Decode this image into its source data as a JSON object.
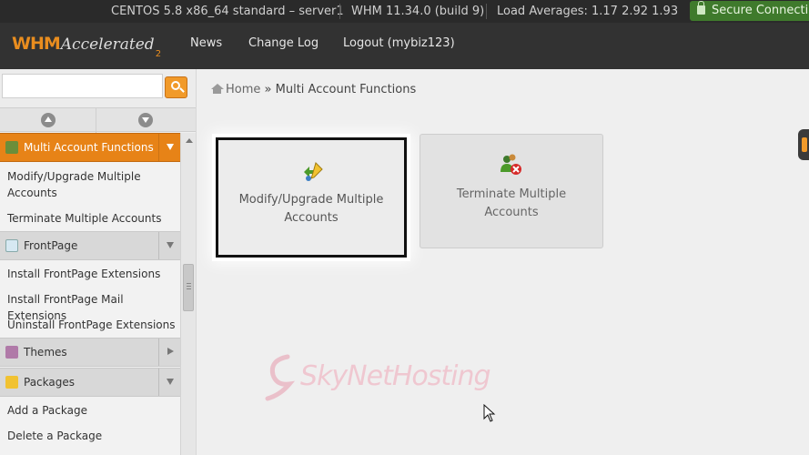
{
  "infobar": {
    "os": "CENTOS 5.8 x86_64 standard – server1",
    "version": "WHM 11.34.0 (build 9)",
    "load": "Load Averages: 1.17 2.92 1.93",
    "secure": "Secure Connection"
  },
  "header": {
    "logo_whm": "WHM",
    "logo_accelerated": "Accelerated",
    "logo_version": "2",
    "nav": [
      "News",
      "Change Log",
      "Logout (mybiz123)"
    ]
  },
  "search": {
    "value": "",
    "placeholder": ""
  },
  "sidebar": {
    "sections": [
      {
        "label": "Multi Account Functions",
        "items": [
          "Modify/Upgrade Multiple Accounts",
          "Terminate Multiple Accounts"
        ]
      },
      {
        "label": "FrontPage",
        "items": [
          "Install FrontPage Extensions",
          "Install FrontPage Mail Extensions",
          "Uninstall FrontPage Extensions"
        ]
      },
      {
        "label": "Themes",
        "items": []
      },
      {
        "label": "Packages",
        "items": [
          "Add a Package",
          "Delete a Package"
        ]
      }
    ]
  },
  "breadcrumb": {
    "home": "Home",
    "separator": "»",
    "current": "Multi Account Functions"
  },
  "tiles": [
    {
      "line1": "Modify/Upgrade Multiple",
      "line2": "Accounts",
      "icon": "modify-accounts-icon"
    },
    {
      "line1": "Terminate Multiple",
      "line2": "Accounts",
      "icon": "terminate-accounts-icon"
    }
  ],
  "watermark": "SkyNetHosting",
  "colors": {
    "accent": "#e78317",
    "header": "#323232",
    "secure": "#3f7a2c"
  }
}
